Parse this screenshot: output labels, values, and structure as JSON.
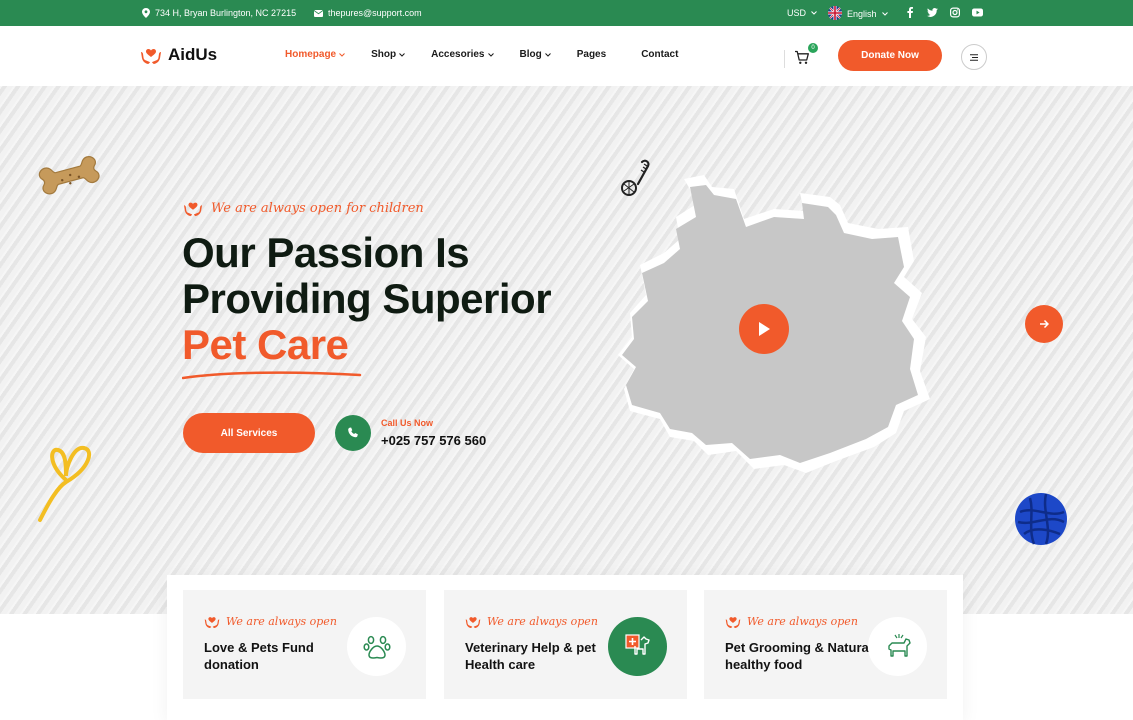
{
  "topbar": {
    "address": "734 H, Bryan Burlington, NC 27215",
    "email": "thepures@support.com",
    "currency": "USD",
    "language": "English",
    "social_icons": [
      "facebook-icon",
      "twitter-icon",
      "instagram-icon",
      "youtube-icon"
    ]
  },
  "header": {
    "logo": "AidUs",
    "nav": [
      {
        "label": "Homepage",
        "active": true,
        "dropdown": true
      },
      {
        "label": "Shop",
        "dropdown": true
      },
      {
        "label": "Accesories",
        "dropdown": true
      },
      {
        "label": "Blog",
        "dropdown": true
      },
      {
        "label": "Pages",
        "dropdown": false
      },
      {
        "label": "Contact",
        "dropdown": false
      }
    ],
    "cart_count": "0",
    "donate_label": "Donate Now"
  },
  "hero": {
    "tagline": "We are always open for children",
    "headline_line1": "Our Passion Is",
    "headline_line2": "Providing Superior",
    "headline_accent": "Pet Care",
    "services_button": "All Services",
    "call_label": "Call Us Now",
    "call_number": "+025 757 576 560"
  },
  "features": [
    {
      "tag": "We are always open",
      "title": "Love & Pets Fund donation",
      "icon": "paw-icon"
    },
    {
      "tag": "We are always open",
      "title": "Veterinary Help & pet Health care",
      "icon": "vet-dog-icon"
    },
    {
      "tag": "We are always open",
      "title": "Pet Grooming & Natural healthy food",
      "icon": "dog-grooming-icon"
    }
  ],
  "colors": {
    "brand_green": "#2a8a52",
    "accent_orange": "#f15a2b",
    "dark_text": "#0f1b12"
  }
}
